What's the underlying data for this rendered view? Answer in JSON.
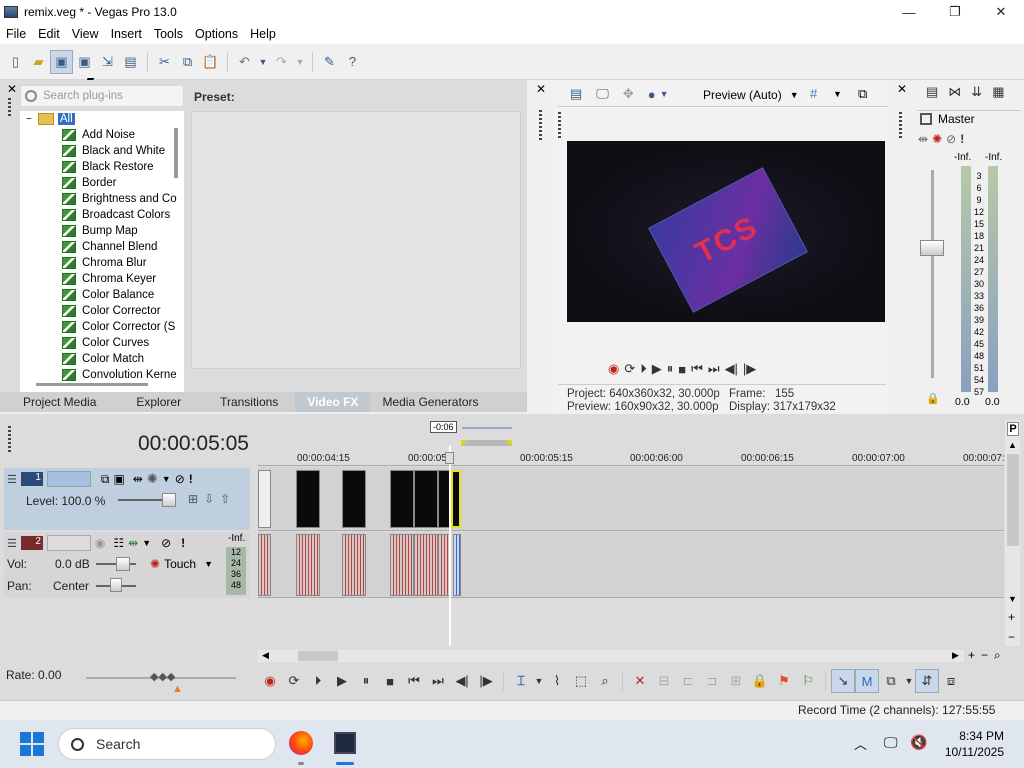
{
  "window": {
    "title": "remix.veg * - Vegas Pro 13.0",
    "min": "—",
    "max": "❐",
    "close": "✕"
  },
  "menu": [
    "File",
    "Edit",
    "View",
    "Insert",
    "Tools",
    "Options",
    "Help"
  ],
  "fx": {
    "search_placeholder": "Search plug-ins",
    "root": "All",
    "items": [
      "Add Noise",
      "Black and White",
      "Black Restore",
      "Border",
      "Brightness and Co",
      "Broadcast Colors",
      "Bump Map",
      "Channel Blend",
      "Chroma Blur",
      "Chroma Keyer",
      "Color Balance",
      "Color Corrector",
      "Color Corrector (S",
      "Color Curves",
      "Color Match",
      "Convolution Kerne"
    ],
    "preset_label": "Preset:"
  },
  "tabs": [
    "Project Media",
    "Explorer",
    "Transitions",
    "Video FX",
    "Media Generators"
  ],
  "preview": {
    "mode": "Preview (Auto)",
    "project_label": "Project:",
    "project": "640x360x32, 30.000p",
    "preview_label": "Preview:",
    "preview": "160x90x32, 30.000p",
    "frame_label": "Frame:",
    "frame": "155",
    "display_label": "Display:",
    "display": "317x179x32"
  },
  "mixer": {
    "master": "Master",
    "inf_l": "-Inf.",
    "inf_r": "-Inf.",
    "scale": [
      "3",
      "6",
      "9",
      "12",
      "15",
      "18",
      "21",
      "24",
      "27",
      "30",
      "33",
      "36",
      "39",
      "42",
      "45",
      "48",
      "51",
      "54",
      "57"
    ],
    "bottom_l": "0.0",
    "bottom_r": "0.0"
  },
  "timeline": {
    "timecode": "00:00:05:05",
    "cursor_tag": "-0:06",
    "ruler": [
      "00:00:04:15",
      "00:00:05",
      "00:00:05:15",
      "00:00:06:00",
      "00:00:06:15",
      "00:00:07:00",
      "00:00:07:"
    ],
    "track1": {
      "num": "1",
      "level_label": "Level:",
      "level": "100.0 %"
    },
    "track2": {
      "num": "2",
      "vol_label": "Vol:",
      "vol": "0.0 dB",
      "pan_label": "Pan:",
      "pan": "Center",
      "mode": "Touch",
      "inf": "-Inf.",
      "meter_scale": [
        "12",
        "24",
        "36",
        "48"
      ]
    },
    "rate": "Rate: 0.00",
    "status": "Record Time (2 channels): 127:55:55"
  },
  "taskbar": {
    "search": "Search",
    "time": "8:34 PM",
    "date": "10/11/2025"
  },
  "colors": {
    "accent": "#c8d8ea",
    "track1": "#bfcfe0",
    "audio_wave": "#b04848"
  }
}
